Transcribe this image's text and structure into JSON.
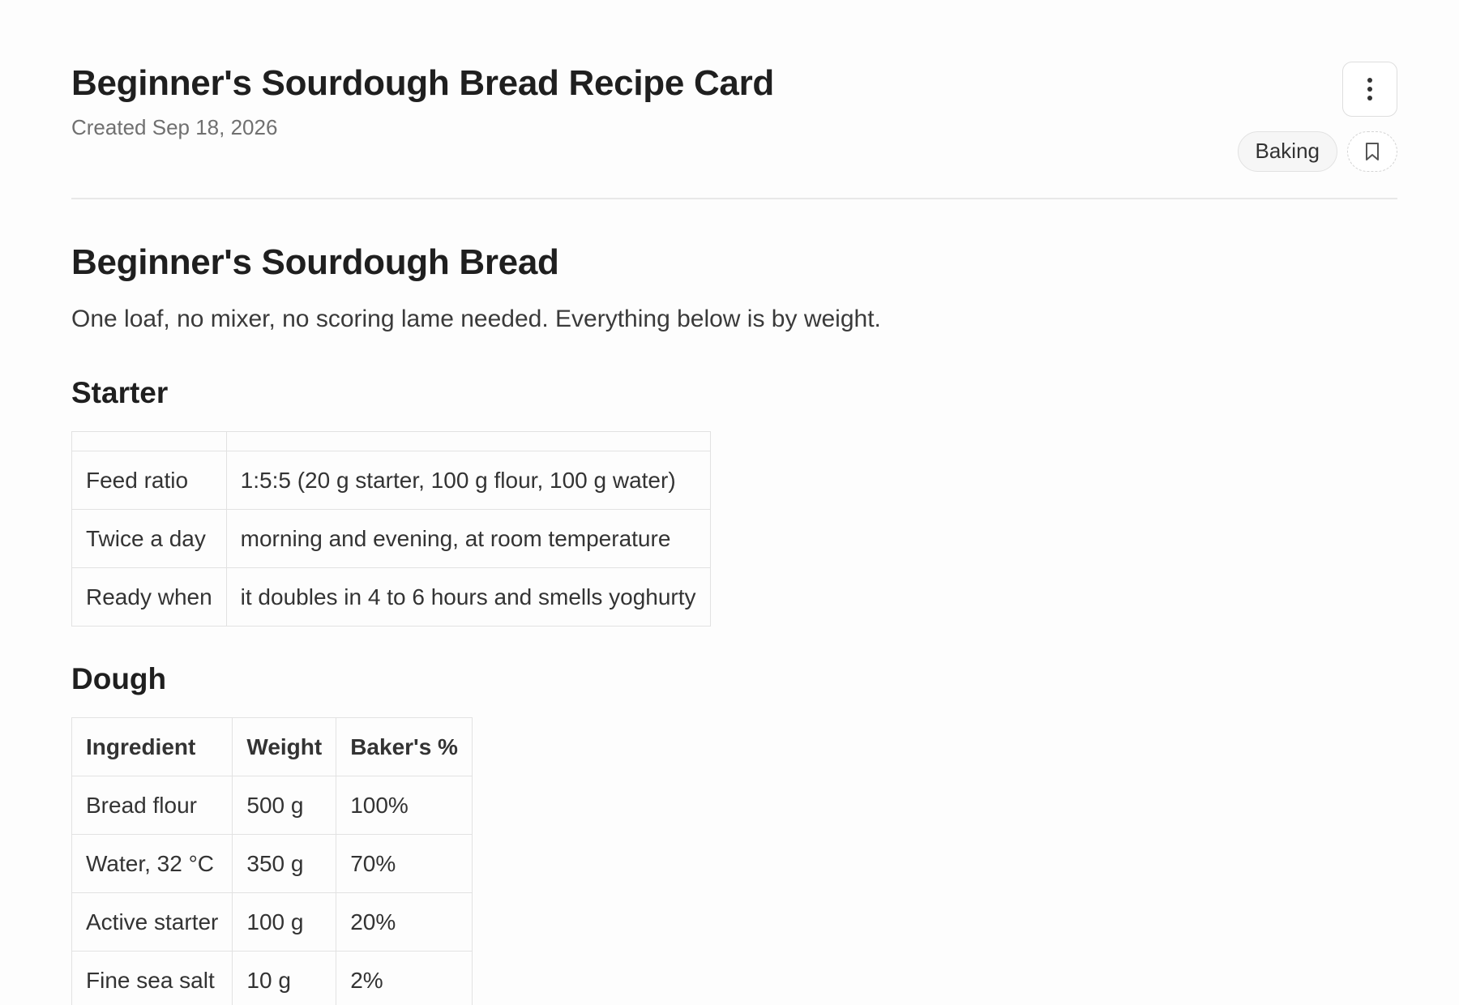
{
  "header": {
    "title": "Beginner's Sourdough Bread Recipe Card",
    "created": "Created Sep 18, 2026",
    "tag": "Baking",
    "more_icon": "more-vertical-icon",
    "bookmark_icon": "bookmark-icon"
  },
  "recipe": {
    "title": "Beginner's Sourdough Bread",
    "intro": "One loaf, no mixer, no scoring lame needed. Everything below is by weight."
  },
  "starter": {
    "heading": "Starter",
    "rows": [
      {
        "label": "Feed ratio",
        "value": "1:5:5 (20 g starter, 100 g flour, 100 g water)"
      },
      {
        "label": "Twice a day",
        "value": "morning and evening, at room temperature"
      },
      {
        "label": "Ready when",
        "value": "it doubles in 4 to 6 hours and smells yoghurty"
      }
    ]
  },
  "dough": {
    "heading": "Dough",
    "columns": [
      "Ingredient",
      "Weight",
      "Baker's %"
    ],
    "rows": [
      [
        "Bread flour",
        "500 g",
        "100%"
      ],
      [
        "Water, 32 °C",
        "350 g",
        "70%"
      ],
      [
        "Active starter",
        "100 g",
        "20%"
      ],
      [
        "Fine sea salt",
        "10 g",
        "2%"
      ]
    ]
  }
}
